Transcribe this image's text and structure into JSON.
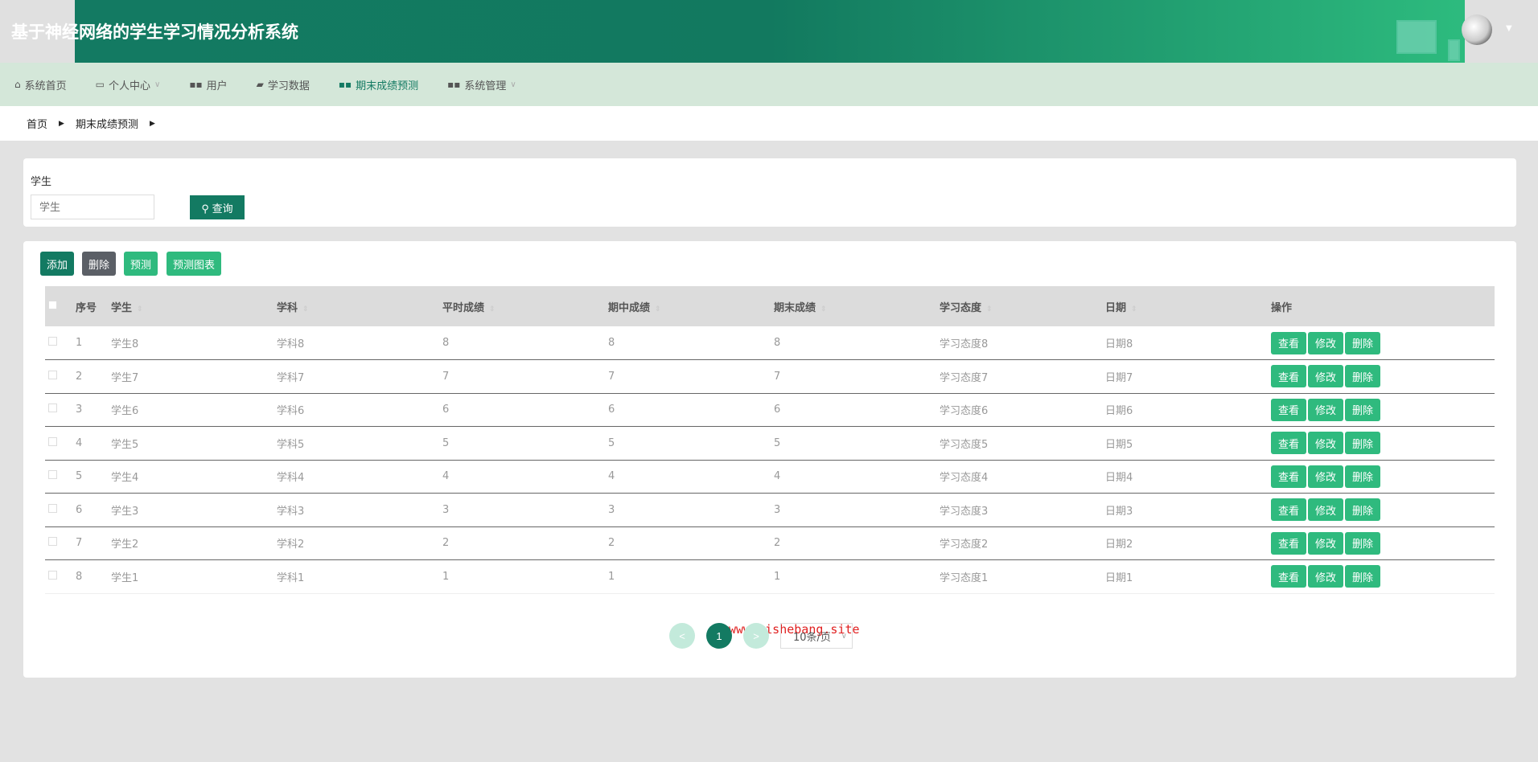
{
  "header": {
    "title": "基于神经网络的学生学习情况分析系统"
  },
  "nav": [
    {
      "label": "系统首页",
      "icon": "home-icon"
    },
    {
      "label": "个人中心",
      "icon": "card-icon",
      "dropdown": true
    },
    {
      "label": "用户",
      "icon": "grid-icon"
    },
    {
      "label": "学习数据",
      "icon": "chat-icon"
    },
    {
      "label": "期末成绩预测",
      "icon": "grid-icon",
      "active": true
    },
    {
      "label": "系统管理",
      "icon": "grid-icon",
      "dropdown": true
    }
  ],
  "breadcrumb": [
    "首页",
    "期末成绩预测"
  ],
  "search": {
    "label": "学生",
    "placeholder": "学生",
    "button": "查询"
  },
  "toolbar": {
    "add": "添加",
    "delete": "删除",
    "predict": "预测",
    "chart": "预测图表"
  },
  "table": {
    "headers": [
      "序号",
      "学生",
      "学科",
      "平时成绩",
      "期中成绩",
      "期末成绩",
      "学习态度",
      "日期",
      "操作"
    ],
    "rows": [
      [
        "1",
        "学生8",
        "学科8",
        "8",
        "8",
        "8",
        "学习态度8",
        "日期8"
      ],
      [
        "2",
        "学生7",
        "学科7",
        "7",
        "7",
        "7",
        "学习态度7",
        "日期7"
      ],
      [
        "3",
        "学生6",
        "学科6",
        "6",
        "6",
        "6",
        "学习态度6",
        "日期6"
      ],
      [
        "4",
        "学生5",
        "学科5",
        "5",
        "5",
        "5",
        "学习态度5",
        "日期5"
      ],
      [
        "5",
        "学生4",
        "学科4",
        "4",
        "4",
        "4",
        "学习态度4",
        "日期4"
      ],
      [
        "6",
        "学生3",
        "学科3",
        "3",
        "3",
        "3",
        "学习态度3",
        "日期3"
      ],
      [
        "7",
        "学生2",
        "学科2",
        "2",
        "2",
        "2",
        "学习态度2",
        "日期2"
      ],
      [
        "8",
        "学生1",
        "学科1",
        "1",
        "1",
        "1",
        "学习态度1",
        "日期1"
      ]
    ],
    "actions": [
      "查看",
      "修改",
      "删除"
    ]
  },
  "pagination": {
    "prev": "<",
    "page": "1",
    "next": ">",
    "size": "10条/页"
  },
  "watermark": "www.bishebang.site",
  "colors": {
    "primary": "#137a62",
    "accent": "#2fba7e",
    "nav_bg": "#d4e7d9"
  }
}
